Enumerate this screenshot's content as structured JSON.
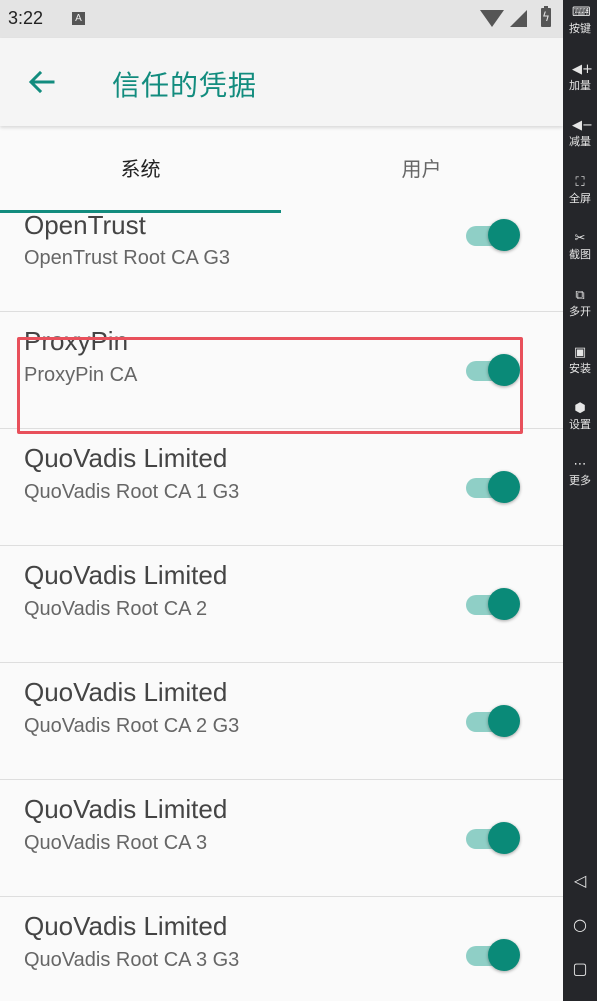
{
  "status_bar": {
    "time": "3:22",
    "notif_icon": "A",
    "icons": [
      "wifi-icon",
      "signal-icon",
      "battery-charging-icon"
    ]
  },
  "app_bar": {
    "title": "信任的凭据",
    "back_icon": "arrow-left-icon"
  },
  "tabs": [
    {
      "label": "系统",
      "selected": true
    },
    {
      "label": "用户",
      "selected": false
    }
  ],
  "colors": {
    "accent": "#128c7e",
    "highlight": "#e8505b",
    "switch_track": "#8fcfc6",
    "switch_thumb": "#0a8a78"
  },
  "certificates": [
    {
      "title": "OpenTrust",
      "subtitle": "OpenTrust Root CA G3",
      "enabled": true
    },
    {
      "title": "ProxyPin",
      "subtitle": "ProxyPin CA",
      "enabled": true,
      "highlighted": true
    },
    {
      "title": "QuoVadis Limited",
      "subtitle": "QuoVadis Root CA 1 G3",
      "enabled": true
    },
    {
      "title": "QuoVadis Limited",
      "subtitle": "QuoVadis Root CA 2",
      "enabled": true
    },
    {
      "title": "QuoVadis Limited",
      "subtitle": "QuoVadis Root CA 2 G3",
      "enabled": true
    },
    {
      "title": "QuoVadis Limited",
      "subtitle": "QuoVadis Root CA 3",
      "enabled": true
    },
    {
      "title": "QuoVadis Limited",
      "subtitle": "QuoVadis Root CA 3 G3",
      "enabled": true
    }
  ],
  "side_toolbar": {
    "items": [
      {
        "label": "按键",
        "icon": "keyboard-icon"
      },
      {
        "label": "加量",
        "icon": "volume-up-icon"
      },
      {
        "label": "减量",
        "icon": "volume-down-icon"
      },
      {
        "label": "全屏",
        "icon": "fullscreen-icon"
      },
      {
        "label": "截图",
        "icon": "scissors-icon"
      },
      {
        "label": "多开",
        "icon": "multi-window-icon"
      },
      {
        "label": "安装",
        "icon": "apk-install-icon"
      },
      {
        "label": "设置",
        "icon": "settings-icon"
      },
      {
        "label": "更多",
        "icon": "more-icon"
      }
    ],
    "nav": [
      "back-triangle-icon",
      "home-circle-icon",
      "recents-square-icon"
    ]
  }
}
